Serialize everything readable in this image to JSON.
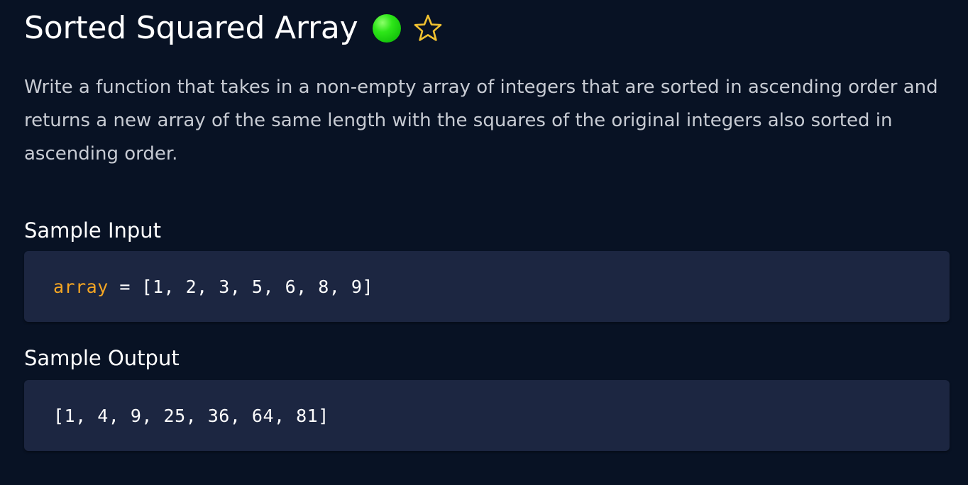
{
  "problem": {
    "title": "Sorted Squared Array",
    "difficulty_color": "#22dd11",
    "favorite_icon": "star-icon",
    "accent_color": "#f2c230",
    "description": "Write a function that takes in a non-empty array of integers that are sorted in ascending order and returns a new array of the same length with the squares of the original integers also sorted in ascending order."
  },
  "sample_input": {
    "heading": "Sample Input",
    "variable": "array",
    "operator": " = ",
    "value": "[1, 2, 3, 5, 6, 8, 9]"
  },
  "sample_output": {
    "heading": "Sample Output",
    "value": "[1, 4, 9, 25, 36, 64, 81]"
  }
}
